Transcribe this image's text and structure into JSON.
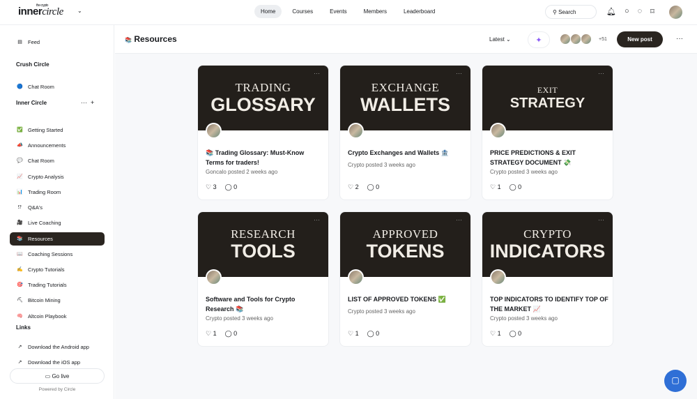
{
  "header": {
    "logo_small": "the crypto",
    "logo_bold": "inner",
    "logo_italic": "circle",
    "nav": [
      "Home",
      "Courses",
      "Events",
      "Members",
      "Leaderboard"
    ],
    "search": "Search"
  },
  "sidebar": {
    "feed": "Feed",
    "sections": [
      {
        "title": "Crush Circle",
        "items": [
          {
            "icon": "🔵",
            "label": "Chat Room"
          }
        ]
      },
      {
        "title": "Inner Circle",
        "items": [
          {
            "icon": "✅",
            "label": "Getting Started"
          },
          {
            "icon": "📣",
            "label": "Announcements"
          },
          {
            "icon": "💬",
            "label": "Chat Room"
          },
          {
            "icon": "📈",
            "label": "Crypto Analysis"
          },
          {
            "icon": "📊",
            "label": "Trading Room"
          },
          {
            "icon": "⁉",
            "label": "Q&A's"
          },
          {
            "icon": "🎥",
            "label": "Live Coaching"
          },
          {
            "icon": "📚",
            "label": "Resources"
          },
          {
            "icon": "📖",
            "label": "Coaching Sessions"
          },
          {
            "icon": "✍",
            "label": "Crypto Tutorials"
          },
          {
            "icon": "🎯",
            "label": "Trading Tutorials"
          },
          {
            "icon": "⛏",
            "label": "Bitcoin Mining"
          },
          {
            "icon": "🧠",
            "label": "Altcoin Playbook"
          }
        ]
      },
      {
        "title": "Links",
        "items": [
          {
            "icon": "↗",
            "label": "Download the Android app"
          },
          {
            "icon": "↗",
            "label": "Download the iOS app"
          }
        ]
      }
    ],
    "go_live": "Go live",
    "powered": "Powered by Circle"
  },
  "main": {
    "icon": "📚",
    "title": "Resources",
    "sort": "Latest",
    "member_count": "+51",
    "new_post": "New post"
  },
  "posts": [
    {
      "l1": "TRADING",
      "l2": "GLOSSARY",
      "title": "📚 Trading Glossary: Must-Know Terms for traders!",
      "meta": "Goncalo posted 2 weeks ago",
      "likes": "3",
      "comments": "0"
    },
    {
      "l1": "EXCHANGE",
      "l2": "WALLETS",
      "title": "Crypto Exchanges and Wallets 🏦",
      "meta": "Crypto posted 3 weeks ago",
      "likes": "2",
      "comments": "0"
    },
    {
      "l1": "EXIT",
      "l2": "STRATEGY",
      "title": "PRICE PREDICTIONS & EXIT STRATEGY DOCUMENT 💸",
      "meta": "Crypto posted 3 weeks ago",
      "likes": "1",
      "comments": "0",
      "small": true
    },
    {
      "l1": "RESEARCH",
      "l2": "TOOLS",
      "title": "Software and Tools for Crypto Research 📚",
      "meta": "Crypto posted 3 weeks ago",
      "likes": "1",
      "comments": "0"
    },
    {
      "l1": "APPROVED",
      "l2": "TOKENS",
      "title": "LIST OF APPROVED TOKENS ✅",
      "meta": "Crypto posted 3 weeks ago",
      "likes": "1",
      "comments": "0"
    },
    {
      "l1": "CRYPTO",
      "l2": "INDICATORS",
      "title": "TOP INDICATORS TO IDENTIFY TOP OF THE MARKET 📈",
      "meta": "Crypto posted 3 weeks ago",
      "likes": "1",
      "comments": "0"
    }
  ]
}
